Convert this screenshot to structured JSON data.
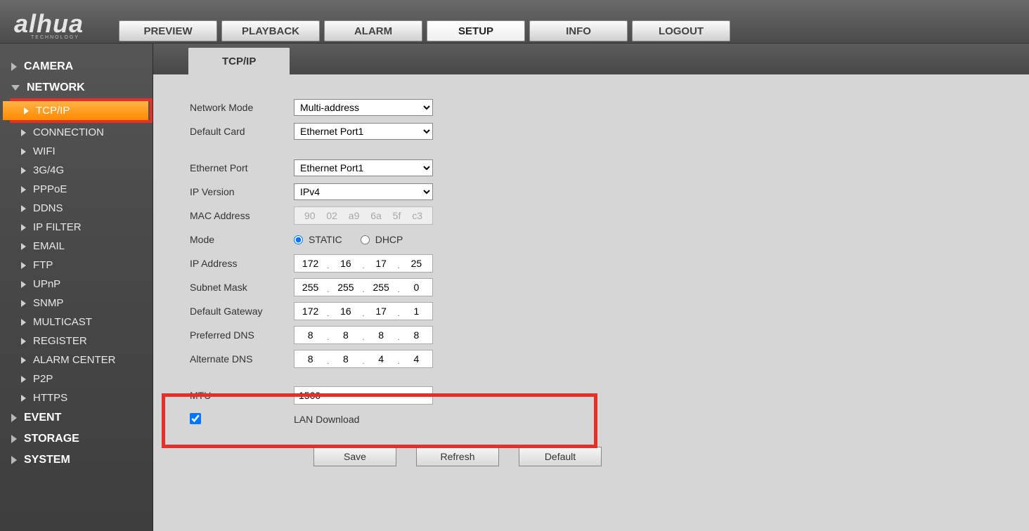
{
  "brand": {
    "name": "alhua",
    "sub": "TECHNOLOGY"
  },
  "topnav": {
    "items": [
      {
        "label": "PREVIEW"
      },
      {
        "label": "PLAYBACK"
      },
      {
        "label": "ALARM"
      },
      {
        "label": "SETUP",
        "active": true
      },
      {
        "label": "INFO"
      },
      {
        "label": "LOGOUT"
      }
    ]
  },
  "sidebar": {
    "camera": "CAMERA",
    "network": "NETWORK",
    "event": "EVENT",
    "storage": "STORAGE",
    "system": "SYSTEM",
    "net_items": [
      "TCP/IP",
      "CONNECTION",
      "WIFI",
      "3G/4G",
      "PPPoE",
      "DDNS",
      "IP FILTER",
      "EMAIL",
      "FTP",
      "UPnP",
      "SNMP",
      "MULTICAST",
      "REGISTER",
      "ALARM CENTER",
      "P2P",
      "HTTPS"
    ]
  },
  "tab": {
    "title": "TCP/IP"
  },
  "form": {
    "network_mode": {
      "label": "Network Mode",
      "value": "Multi-address"
    },
    "default_card": {
      "label": "Default Card",
      "value": "Ethernet Port1"
    },
    "ethernet_port": {
      "label": "Ethernet Port",
      "value": "Ethernet Port1"
    },
    "ip_version": {
      "label": "IP Version",
      "value": "IPv4"
    },
    "mac": {
      "label": "MAC Address",
      "value": [
        "90",
        "02",
        "a9",
        "6a",
        "5f",
        "c3"
      ]
    },
    "mode": {
      "label": "Mode",
      "static": "STATIC",
      "dhcp": "DHCP",
      "selected": "STATIC"
    },
    "ip": {
      "label": "IP Address",
      "o": [
        "172",
        "16",
        "17",
        "25"
      ]
    },
    "sm": {
      "label": "Subnet Mask",
      "o": [
        "255",
        "255",
        "255",
        "0"
      ]
    },
    "gw": {
      "label": "Default Gateway",
      "o": [
        "172",
        "16",
        "17",
        "1"
      ]
    },
    "pdns": {
      "label": "Preferred DNS",
      "o": [
        "8",
        "8",
        "8",
        "8"
      ]
    },
    "adns": {
      "label": "Alternate DNS",
      "o": [
        "8",
        "8",
        "4",
        "4"
      ]
    },
    "mtu": {
      "label": "MTU",
      "value": "1500"
    },
    "lan": {
      "label": "LAN Download",
      "checked": true
    },
    "buttons": {
      "save": "Save",
      "refresh": "Refresh",
      "default": "Default"
    }
  }
}
